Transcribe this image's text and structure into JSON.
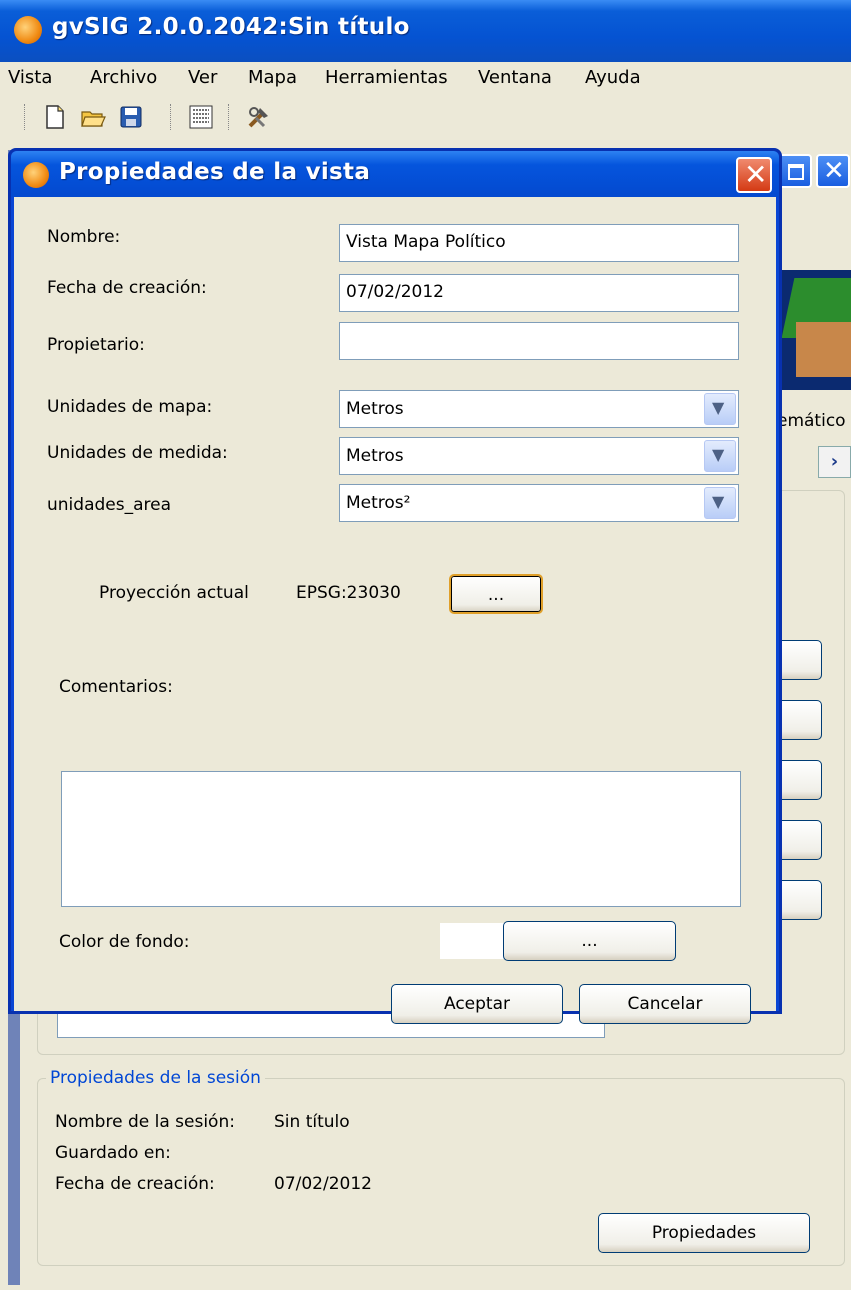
{
  "app": {
    "title": "gvSIG 2.0.0.2042:Sin título"
  },
  "menu": [
    "Vista",
    "Archivo",
    "Ver",
    "Mapa",
    "Herramientas",
    "Ventana",
    "Ayuda"
  ],
  "toolbar_icons": [
    "new-document-icon",
    "open-folder-icon",
    "save-icon",
    "preferences-icon",
    "tools-icon"
  ],
  "background": {
    "partial_label": "emático",
    "session": {
      "legend": "Propiedades de la sesión",
      "name_label": "Nombre de la sesión:",
      "name_value": "Sin título",
      "saved_label": "Guardado en:",
      "saved_value": "",
      "date_label": "Fecha de creación:",
      "date_value": "07/02/2012",
      "props_button": "Propiedades"
    }
  },
  "dialog": {
    "title": "Propiedades de la vista",
    "fields": {
      "nombre_label": "Nombre:",
      "nombre_value": "Vista Mapa Político",
      "fecha_label": "Fecha de creación:",
      "fecha_value": "07/02/2012",
      "propietario_label": "Propietario:",
      "propietario_value": "",
      "unidades_mapa_label": "Unidades de mapa:",
      "unidades_mapa_value": "Metros",
      "unidades_medida_label": "Unidades de medida:",
      "unidades_medida_value": "Metros",
      "unidades_area_label": "unidades_area",
      "unidades_area_value": "Metros²"
    },
    "projection": {
      "label": "Proyección actual",
      "value": "EPSG:23030",
      "button": "..."
    },
    "comments_label": "Comentarios:",
    "comments_value": "",
    "color_label": "Color de fondo:",
    "color_value": "#ffffff",
    "color_button": "...",
    "accept": "Aceptar",
    "cancel": "Cancelar"
  }
}
